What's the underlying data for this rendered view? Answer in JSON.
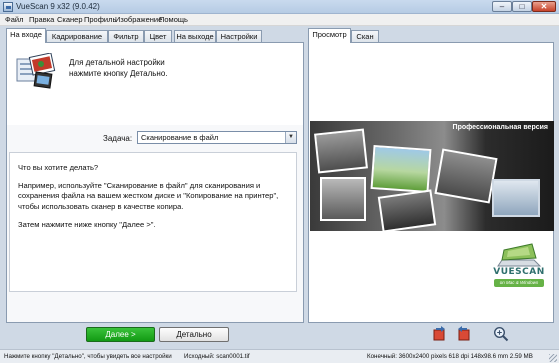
{
  "window": {
    "title": "VueScan 9 x32 (9.0.42)"
  },
  "menu": [
    "Файл",
    "Правка",
    "Сканер",
    "Профиль",
    "Изображение",
    "Помощь"
  ],
  "left_tabs": [
    "На входе",
    "Кадрирование",
    "Фильтр",
    "Цвет",
    "На выходе",
    "Настройки"
  ],
  "right_tabs": [
    "Просмотр",
    "Скан"
  ],
  "header": {
    "line1": "Для детальной настройки",
    "line2": "нажмите кнопку Детально."
  },
  "task": {
    "label": "Задача:",
    "value": "Сканирование в файл"
  },
  "help": {
    "q": "Что вы хотите делать?",
    "p1": "Например, используйте \"Сканирование в файл\" для сканирования и сохранения файла на вашем жестком диске и \"Копирование на принтер\", чтобы использовать сканер в качестве копира.",
    "p2": "Затем нажмите ниже кнопку \"Далее >\"."
  },
  "preview": {
    "caption": "Профессиональная версия"
  },
  "logo": {
    "name": "VUESCAN",
    "tagline": "on Mac & Windows"
  },
  "buttons": {
    "next": "Далее >",
    "detail": "Детально"
  },
  "status": {
    "hint": "Нажмите кнопку \"Детально\", чтобы увидеть все настройки",
    "source": "Исходный: scan0001.tif",
    "final": "Конечный: 3600x2400 pixels 618 dpi 148x98.6 mm 2.59 MB"
  },
  "colors": {
    "next_button": "#1aa11c",
    "titlebar": "#b9cde6",
    "logo_green": "#66b246"
  }
}
